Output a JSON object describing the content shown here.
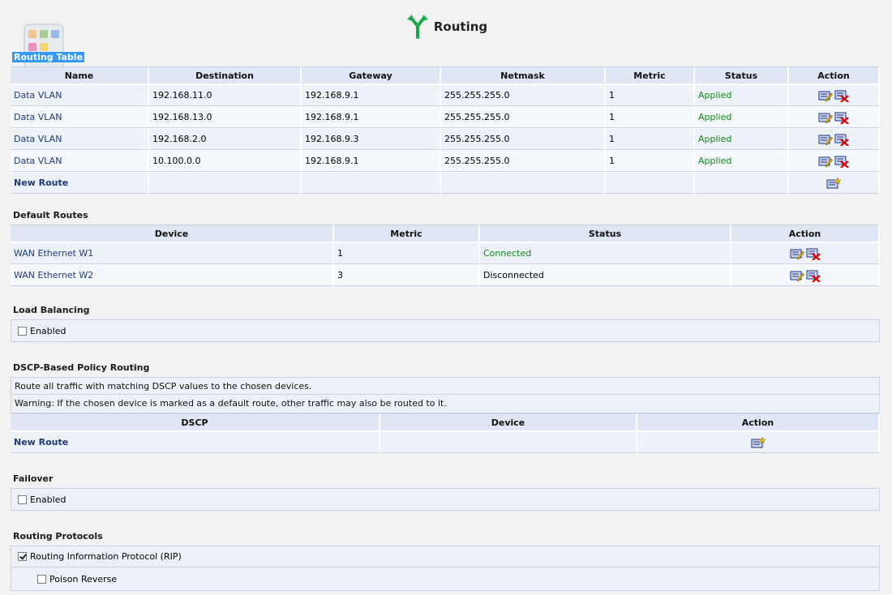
{
  "page": {
    "title": "Routing",
    "icon": "routing-fork-icon",
    "accent": "#1aa84a"
  },
  "routing_table": {
    "title": "Routing Table",
    "columns": [
      "Name",
      "Destination",
      "Gateway",
      "Netmask",
      "Metric",
      "Status",
      "Action"
    ],
    "rows": [
      {
        "name": "Data VLAN",
        "destination": "192.168.11.0",
        "gateway": "192.168.9.1",
        "netmask": "255.255.255.0",
        "metric": "1",
        "status": "Applied"
      },
      {
        "name": "Data VLAN",
        "destination": "192.168.13.0",
        "gateway": "192.168.9.1",
        "netmask": "255.255.255.0",
        "metric": "1",
        "status": "Applied"
      },
      {
        "name": "Data VLAN",
        "destination": "192.168.2.0",
        "gateway": "192.168.9.3",
        "netmask": "255.255.255.0",
        "metric": "1",
        "status": "Applied"
      },
      {
        "name": "Data VLAN",
        "destination": "10.100.0.0",
        "gateway": "192.168.9.1",
        "netmask": "255.255.255.0",
        "metric": "1",
        "status": "Applied"
      }
    ],
    "new_route_label": "New Route"
  },
  "default_routes": {
    "title": "Default Routes",
    "columns": [
      "Device",
      "Metric",
      "Status",
      "Action"
    ],
    "rows": [
      {
        "device": "WAN Ethernet W1",
        "metric": "1",
        "status": "Connected"
      },
      {
        "device": "WAN Ethernet W2",
        "metric": "3",
        "status": "Disconnected"
      }
    ]
  },
  "load_balancing": {
    "title": "Load Balancing",
    "enabled_label": "Enabled",
    "enabled": false
  },
  "dscp": {
    "title": "DSCP-Based Policy Routing",
    "info": "Route all traffic with matching DSCP values to the chosen devices.",
    "warning": "Warning: If the chosen device is marked as a default route, other traffic may also be routed to it.",
    "columns": [
      "DSCP",
      "Device",
      "Action"
    ],
    "new_route_label": "New Route"
  },
  "failover": {
    "title": "Failover",
    "enabled_label": "Enabled",
    "enabled": false
  },
  "routing_protocols": {
    "title": "Routing Protocols",
    "rip_label": "Routing Information Protocol (RIP)",
    "rip_enabled": true,
    "poison_label": "Poison Reverse",
    "poison_enabled": false
  },
  "colors": {
    "link": "#1f3a7a",
    "applied": "#0e8a16",
    "header_bg": "#dfe7f4",
    "row_bg": "#edf2f9"
  }
}
